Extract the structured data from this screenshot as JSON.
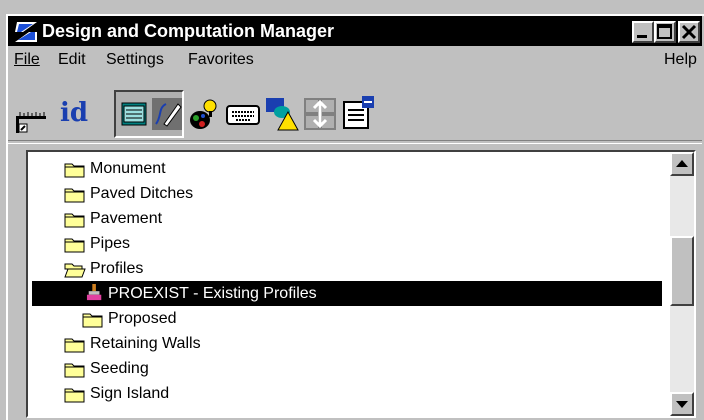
{
  "window": {
    "title": "Design and Computation Manager"
  },
  "menu": {
    "file": "File",
    "edit": "Edit",
    "settings": "Settings",
    "favorites": "Favorites",
    "help": "Help"
  },
  "toolbar": {
    "id_label": "id",
    "icons": [
      "ruler-icon",
      "id-icon",
      "dialog-icon",
      "pencil-icon",
      "palette-icon",
      "keyboard-icon",
      "shapes-icon",
      "grid-icon",
      "properties-icon"
    ]
  },
  "tree": {
    "items": [
      {
        "label": "Monument",
        "type": "folder"
      },
      {
        "label": "Paved Ditches",
        "type": "folder"
      },
      {
        "label": "Pavement",
        "type": "folder"
      },
      {
        "label": "Pipes",
        "type": "folder"
      },
      {
        "label": "Profiles",
        "type": "folder-open"
      },
      {
        "label": "PROEXIST - Existing Profiles",
        "type": "item",
        "selected": true
      },
      {
        "label": "Proposed",
        "type": "folder"
      },
      {
        "label": "Retaining Walls",
        "type": "folder"
      },
      {
        "label": "Seeding",
        "type": "folder"
      },
      {
        "label": "Sign Island",
        "type": "folder"
      }
    ]
  },
  "colors": {
    "titlebar": "#000000",
    "selection": "#000000",
    "folder": "#ffff99",
    "face": "#c0c0c0"
  }
}
